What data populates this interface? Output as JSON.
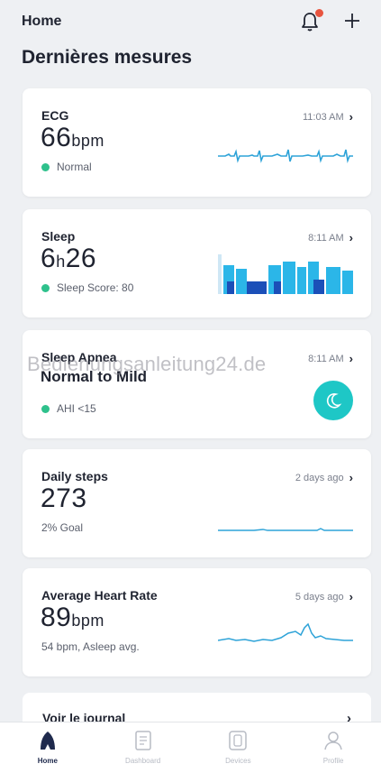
{
  "header": {
    "title": "Home",
    "bell_icon": "bell-icon",
    "plus_icon": "plus-icon",
    "notification_color": "#e8553f"
  },
  "section": {
    "title": "Dernières mesures"
  },
  "cards": {
    "ecg": {
      "label": "ECG",
      "value": "66",
      "unit": "bpm",
      "time": "11:03 AM",
      "status": "Normal"
    },
    "sleep": {
      "label": "Sleep",
      "hours": "6",
      "h": "h",
      "minutes": "26",
      "time": "8:11 AM",
      "status": "Sleep Score: 80"
    },
    "apnea": {
      "label": "Sleep Apnea",
      "value": "Normal to Mild",
      "time": "8:11 AM",
      "status": "AHI <15"
    },
    "steps": {
      "label": "Daily steps",
      "value": "273",
      "time": "2 days ago",
      "status": "2% Goal"
    },
    "heart": {
      "label": "Average Heart Rate",
      "value": "89",
      "unit": "bpm",
      "time": "5 days ago",
      "status": "54 bpm, Asleep avg."
    }
  },
  "watermark": "Bedienungsanleitung24.de",
  "journal": {
    "label": "Voir le journal"
  },
  "tabs": [
    {
      "label": "Home",
      "icon": "home-icon"
    },
    {
      "label": "Dashboard",
      "icon": "dashboard-icon"
    },
    {
      "label": "Devices",
      "icon": "device-icon"
    },
    {
      "label": "Profile",
      "icon": "profile-icon"
    }
  ],
  "colors": {
    "accent": "#1ec7c6",
    "ok": "#2ec18c",
    "chart_line": "#2ea3d8",
    "sleep_light": "#2bb6e8",
    "sleep_deep": "#1b4fb8"
  }
}
